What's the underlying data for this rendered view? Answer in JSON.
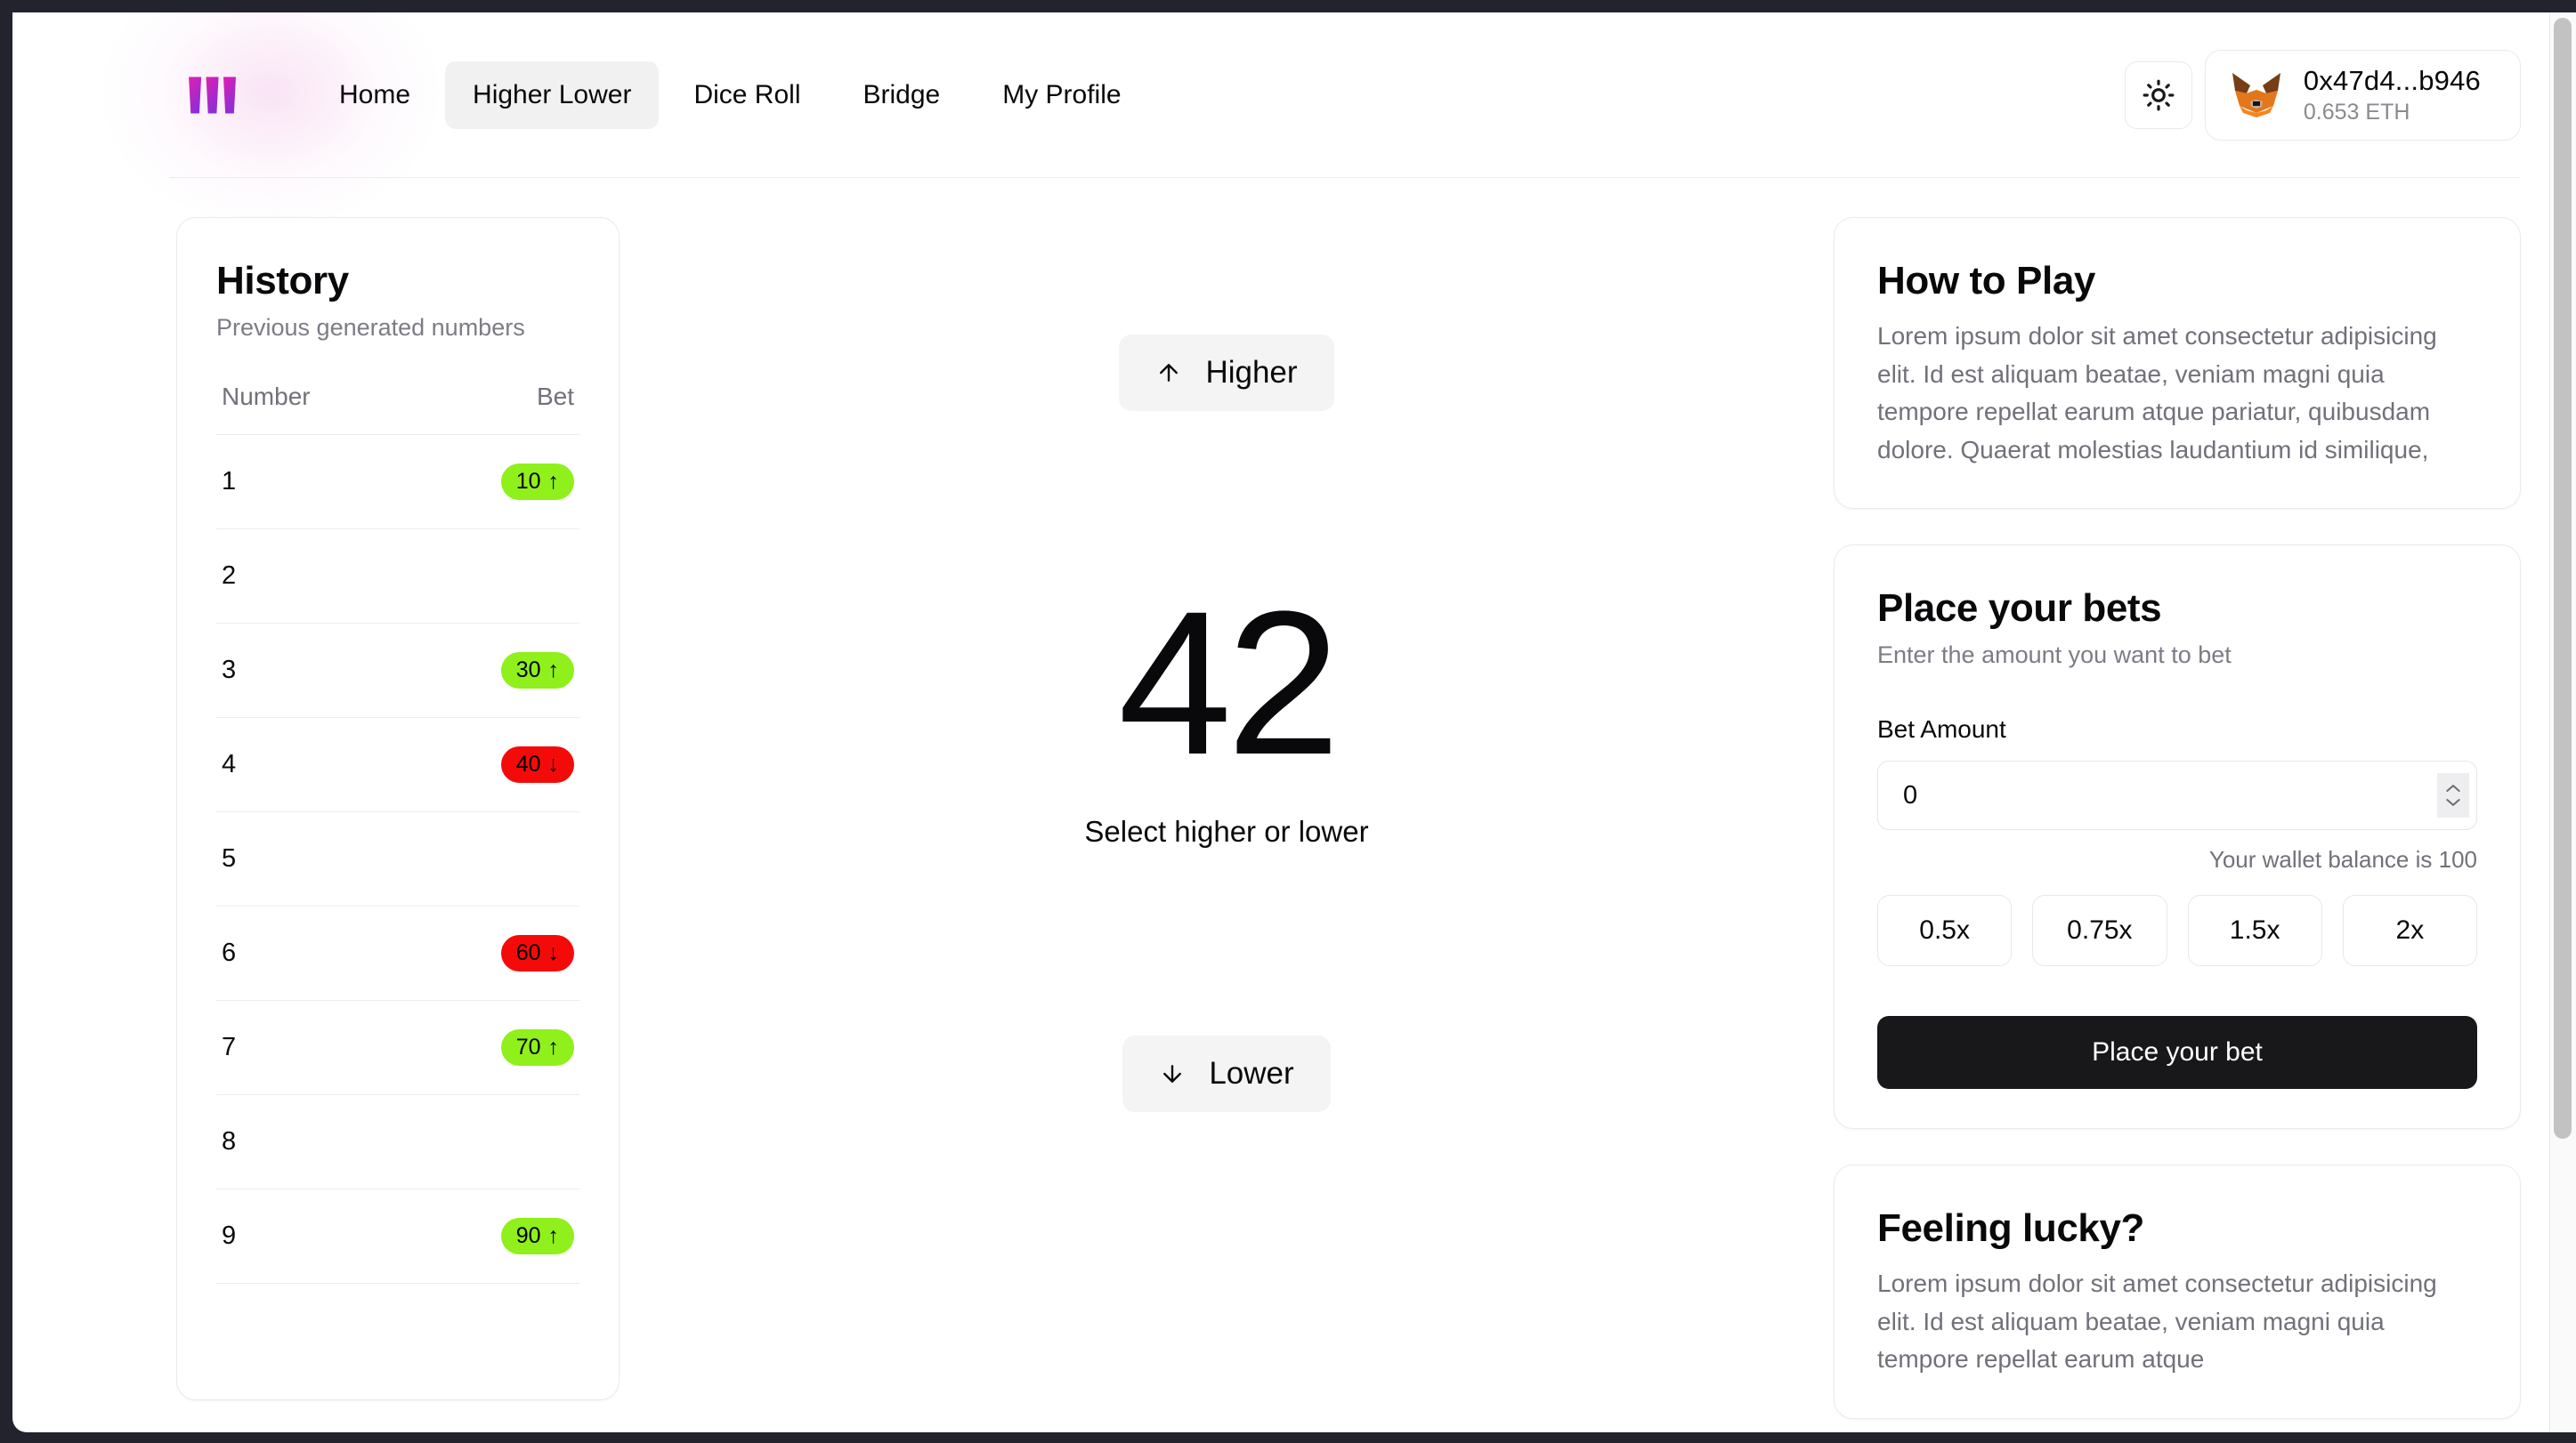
{
  "brand": {
    "logo_icon": "w-logo-icon",
    "gradient_start": "#e11fb0",
    "gradient_end": "#8b2fd6"
  },
  "nav": {
    "items": [
      {
        "label": "Home",
        "active": false
      },
      {
        "label": "Higher Lower",
        "active": true
      },
      {
        "label": "Dice Roll",
        "active": false
      },
      {
        "label": "Bridge",
        "active": false
      },
      {
        "label": "My Profile",
        "active": false
      }
    ],
    "theme_toggle_icon": "sun-icon",
    "wallet": {
      "avatar_icon": "metamask-fox-icon",
      "address": "0x47d4...b946",
      "balance": "0.653 ETH"
    }
  },
  "history": {
    "title": "History",
    "subtitle": "Previous generated numbers",
    "columns": [
      "Number",
      "Bet"
    ],
    "rows": [
      {
        "number": "1",
        "bet": "10",
        "direction": "up",
        "arrow": "↑"
      },
      {
        "number": "2",
        "bet": "",
        "direction": "none",
        "arrow": ""
      },
      {
        "number": "3",
        "bet": "30",
        "direction": "up",
        "arrow": "↑"
      },
      {
        "number": "4",
        "bet": "40",
        "direction": "down",
        "arrow": "↓"
      },
      {
        "number": "5",
        "bet": "",
        "direction": "none",
        "arrow": ""
      },
      {
        "number": "6",
        "bet": "60",
        "direction": "down",
        "arrow": "↓"
      },
      {
        "number": "7",
        "bet": "70",
        "direction": "up",
        "arrow": "↑"
      },
      {
        "number": "8",
        "bet": "",
        "direction": "none",
        "arrow": ""
      },
      {
        "number": "9",
        "bet": "90",
        "direction": "up",
        "arrow": "↑"
      }
    ],
    "badge_up_color": "#8ff01b",
    "badge_down_color": "#f50a0a"
  },
  "game": {
    "higher_label": "Higher",
    "higher_icon": "arrow-up-icon",
    "lower_label": "Lower",
    "lower_icon": "arrow-down-icon",
    "current_number": "42",
    "caption": "Select higher or lower"
  },
  "how_to_play": {
    "title": "How to Play",
    "body": "Lorem ipsum dolor sit amet consectetur adipisicing elit. Id est aliquam beatae, veniam magni quia tempore repellat earum atque pariatur, quibusdam dolore. Quaerat molestias laudantium id similique,"
  },
  "place_bets": {
    "title": "Place your bets",
    "subtitle": "Enter the amount you want to bet",
    "amount_label": "Bet Amount",
    "amount_value": "0",
    "amount_placeholder": "0",
    "balance_note": "Your wallet balance is 100",
    "multipliers": [
      "0.5x",
      "0.75x",
      "1.5x",
      "2x"
    ],
    "submit_label": "Place your bet",
    "submit_bg": "#18181b"
  },
  "feeling_lucky": {
    "title": "Feeling lucky?",
    "body": "Lorem ipsum dolor sit amet consectetur adipisicing elit. Id est aliquam beatae, veniam magni quia tempore repellat earum atque"
  }
}
